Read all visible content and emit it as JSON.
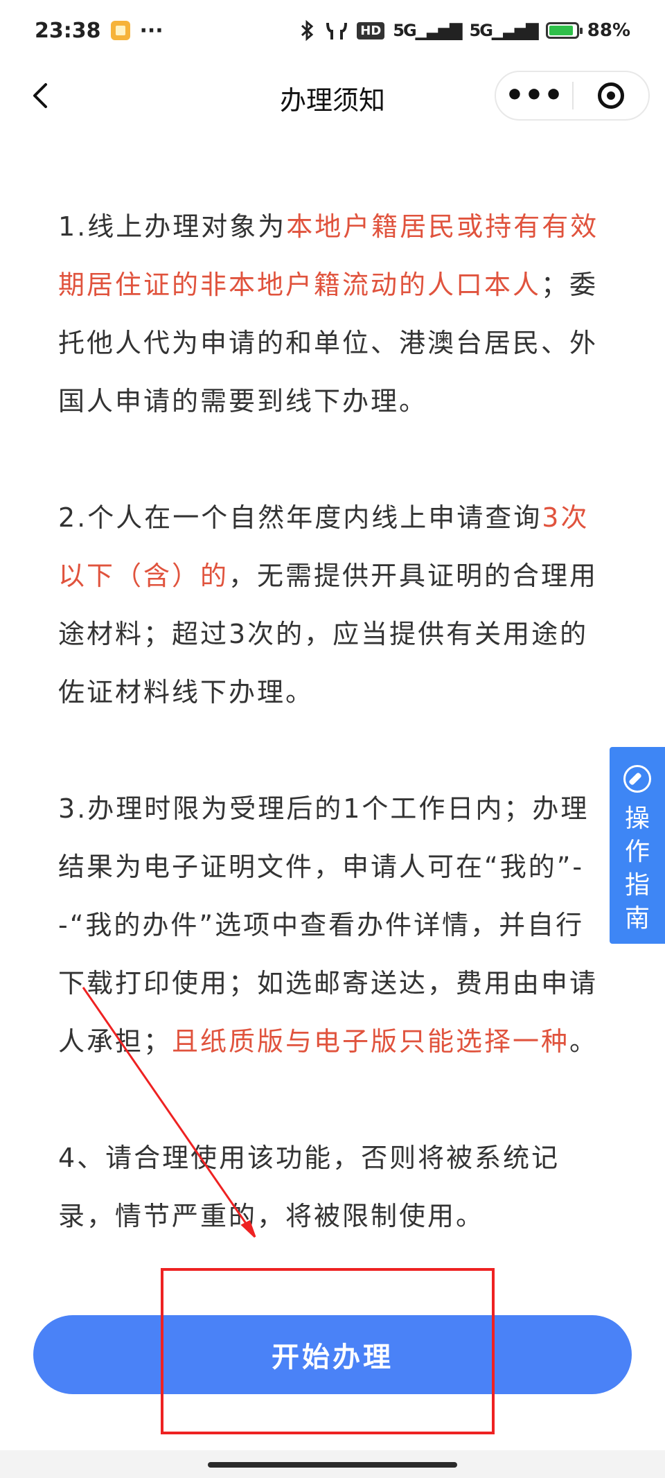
{
  "status_bar": {
    "time": "23:38",
    "more": "···",
    "network_5g_1": "5G",
    "network_5g_2": "5G",
    "hd_label": "HD",
    "battery": "88%"
  },
  "nav": {
    "title": "办理须知",
    "more_label": "•••"
  },
  "content": {
    "p1": {
      "a": "1.线上办理对象为",
      "b": "本地户籍居民或持有有效期居住证的非本地户籍流动的人口本人",
      "c": "；委托他人代为申请的和单位、港澳台居民、外国人申请的需要到线下办理。"
    },
    "p2": {
      "a": "2.个人在一个自然年度内线上申请查询",
      "b": "3次以下（含）的",
      "c": "，无需提供开具证明的合理用途材料；超过3次的，应当提供有关用途的佐证材料线下办理。"
    },
    "p3": {
      "a": "3.办理时限为受理后的1个工作日内；办理结果为电子证明文件，申请人可在“我的”--“我的办件”选项中查看办件详情，并自行下载打印使用；如选邮寄送达，费用由申请人承担；",
      "b": "且纸质版与电子版只能选择一种",
      "c": "。"
    },
    "p4": "4、请合理使用该功能，否则将被系统记录，情节严重的，将被限制使用。"
  },
  "guide": {
    "label": "操作指南"
  },
  "start_button": {
    "label": "开始办理"
  },
  "colors": {
    "highlight": "#e0533d",
    "primary": "#4a82f7",
    "annotation": "#ee2222"
  }
}
